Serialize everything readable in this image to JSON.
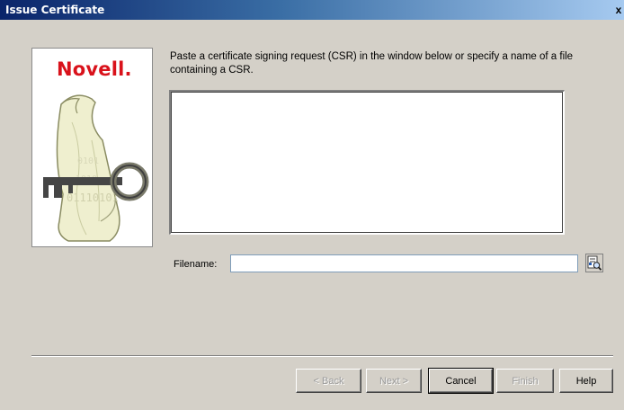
{
  "window": {
    "title": "Issue Certificate",
    "close_label": "x"
  },
  "brand": {
    "logo_text": "Novell."
  },
  "main": {
    "instructions": "Paste a certificate signing request (CSR) in the window below or specify a name of a file containing a CSR.",
    "csr_value": "",
    "filename_label": "Filename:",
    "filename_value": ""
  },
  "buttons": {
    "back": "< Back",
    "next": "Next >",
    "cancel": "Cancel",
    "finish": "Finish",
    "help": "Help"
  },
  "icons": {
    "browse": "file-browse-icon",
    "logo_art": "key-scroll-icon"
  }
}
